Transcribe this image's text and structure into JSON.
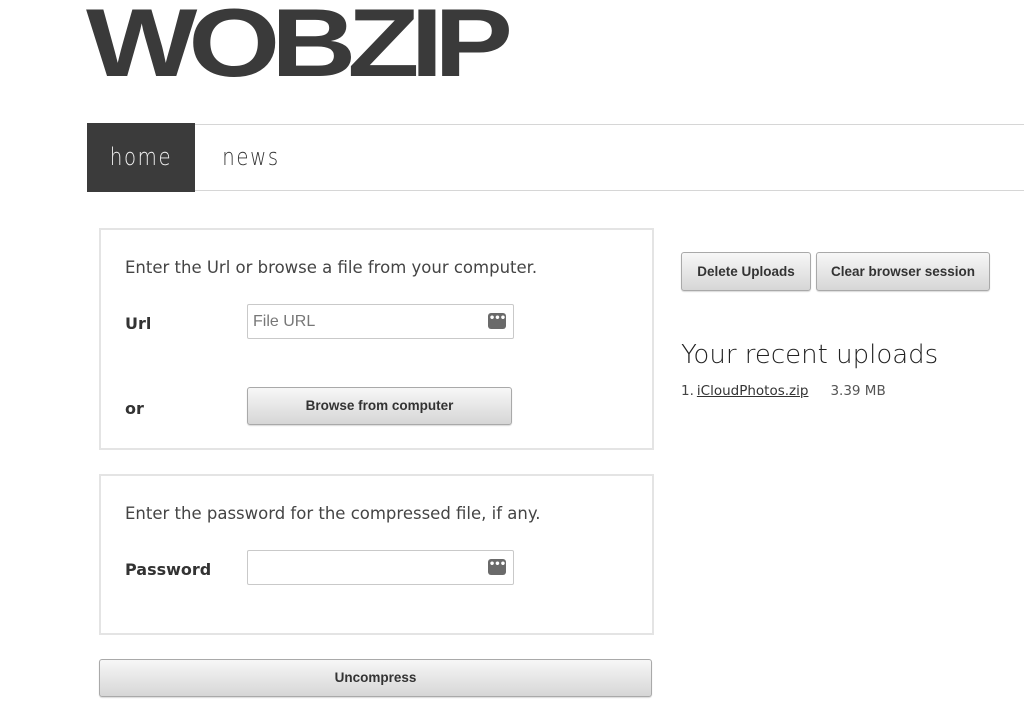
{
  "logo": {
    "text": "WOBZIP"
  },
  "nav": {
    "items": [
      {
        "label": "home",
        "active": true
      },
      {
        "label": "news",
        "active": false
      }
    ]
  },
  "url_panel": {
    "intro": "Enter the Url or browse a file from your computer.",
    "url_label": "Url",
    "url_placeholder": "File URL",
    "url_value": "",
    "or_label": "or",
    "browse_button": "Browse from computer"
  },
  "password_panel": {
    "intro": "Enter the password for the compressed file, if any.",
    "password_label": "Password",
    "password_value": ""
  },
  "actions": {
    "uncompress_button": "Uncompress",
    "delete_uploads_button": "Delete Uploads",
    "clear_session_button": "Clear browser session"
  },
  "recent": {
    "title": "Your recent uploads",
    "items": [
      {
        "index": "1.",
        "name": "iCloudPhotos.zip",
        "size": "3.39 MB"
      }
    ]
  },
  "icons": {
    "key_icon": "password-manager-key-icon"
  },
  "colors": {
    "logo": "#3a3a3a",
    "nav_active_bg": "#3b3b3b",
    "panel_border": "#e4e4e4"
  }
}
